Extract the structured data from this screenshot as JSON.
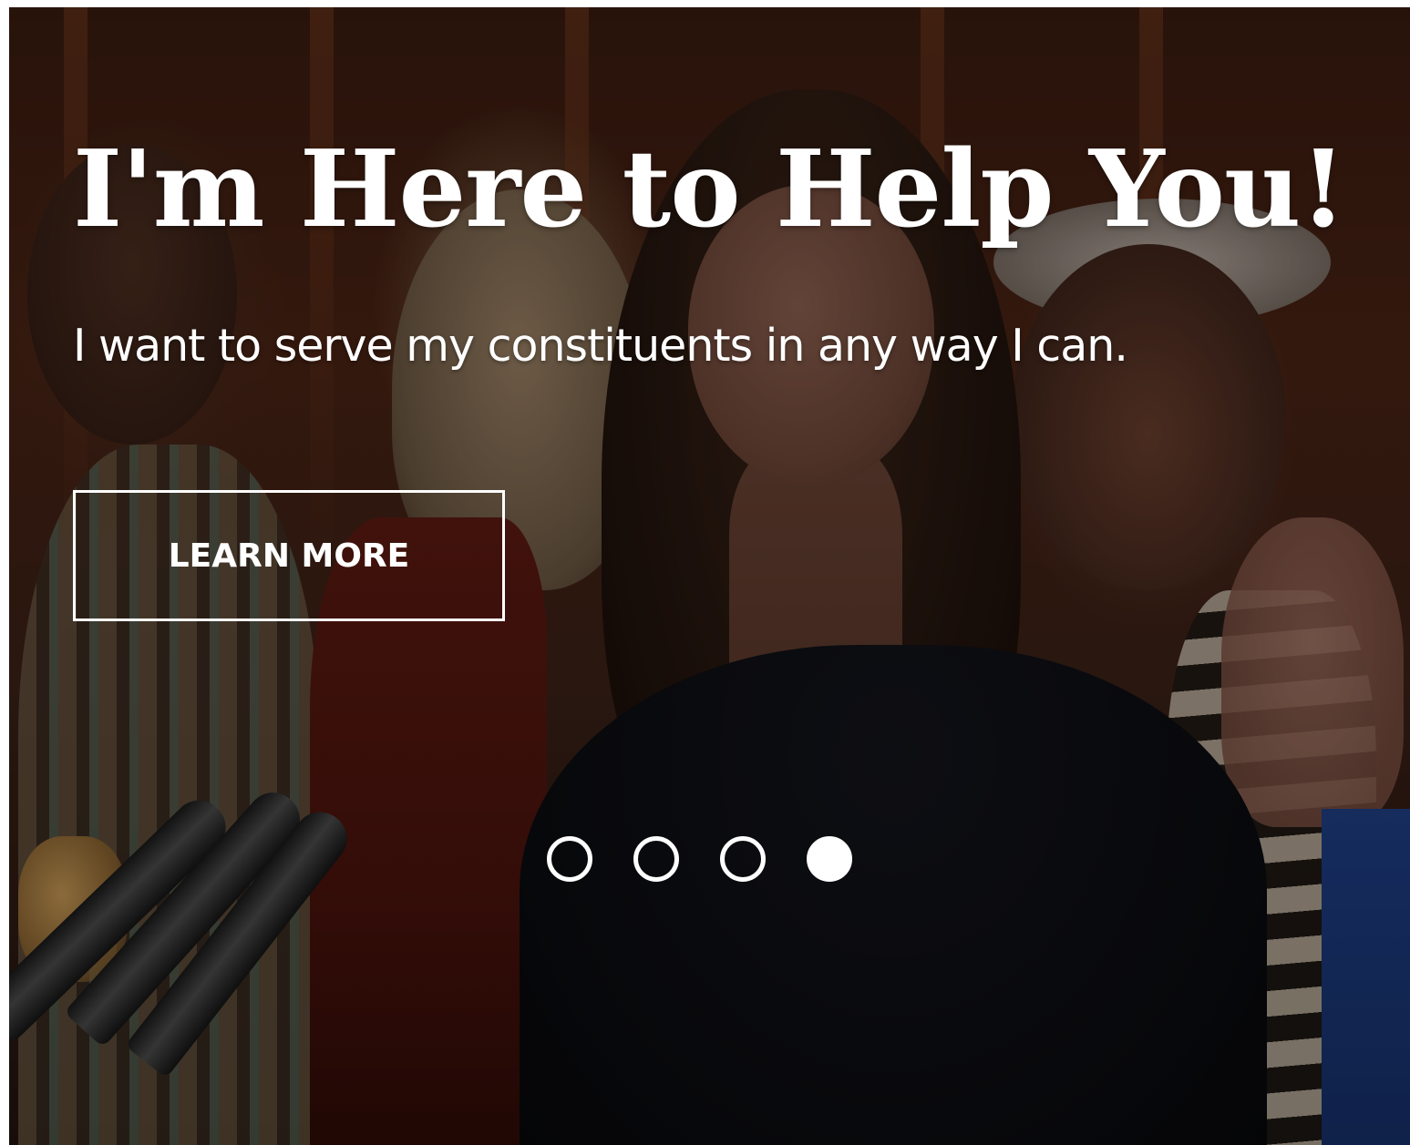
{
  "hero": {
    "headline": "I'm Here to Help You!",
    "subheadline": "I want to serve my constituents in any way I can.",
    "cta_label": "LEARN MORE",
    "background_image": "photo of smiling woman in dark dress at a podium with microphones, colleagues in background"
  },
  "carousel": {
    "slide_count": 4,
    "active_slide": 4,
    "dots": [
      {
        "state": "inactive"
      },
      {
        "state": "inactive"
      },
      {
        "state": "inactive"
      },
      {
        "state": "active"
      }
    ]
  },
  "colors": {
    "text": "#ffffff",
    "button_border": "#ffffff",
    "dot_active": "#ffffff"
  }
}
